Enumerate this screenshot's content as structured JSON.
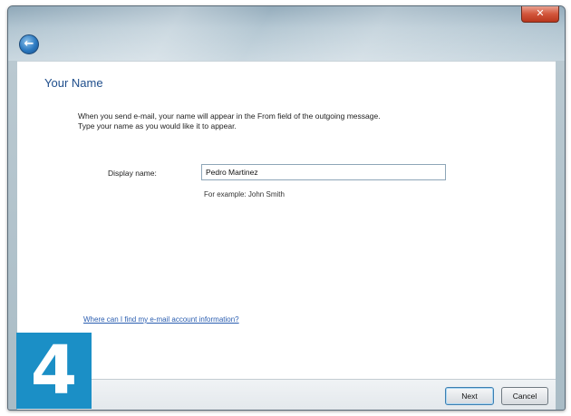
{
  "window": {
    "close_glyph": "✕",
    "back_glyph": "←"
  },
  "page": {
    "heading": "Your Name",
    "description_line1": "When you send e-mail, your name will appear in the From field of the outgoing message.",
    "description_line2": "Type your name as you would like it to appear."
  },
  "form": {
    "display_name_label": "Display name:",
    "display_name_value": "Pedro Martinez",
    "example_hint": "For example: John Smith"
  },
  "help_link": "Where can I find my e-mail account information?",
  "buttons": {
    "next": "Next",
    "cancel": "Cancel"
  },
  "step_badge": "4",
  "colors": {
    "heading": "#1f4e8c",
    "link": "#2a5db0",
    "badge": "#1b8fc6",
    "close_button": "#d2553b"
  },
  "icons": {
    "back": "back-arrow-icon",
    "close": "close-icon"
  }
}
